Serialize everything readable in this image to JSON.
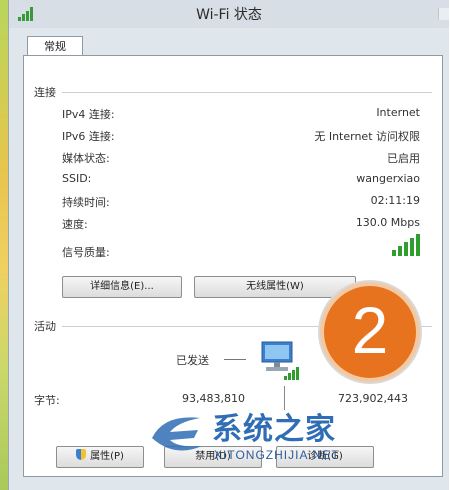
{
  "window": {
    "title": "Wi-Fi 状态"
  },
  "tab": {
    "label": "常规"
  },
  "connection": {
    "section_label": "连接",
    "rows": [
      {
        "label": "IPv4 连接:",
        "value": "Internet"
      },
      {
        "label": "IPv6 连接:",
        "value": "无 Internet 访问权限"
      },
      {
        "label": "媒体状态:",
        "value": "已启用"
      },
      {
        "label": "SSID:",
        "value": "wangerxiao"
      },
      {
        "label": "持续时间:",
        "value": "02:11:19"
      },
      {
        "label": "速度:",
        "value": "130.0 Mbps"
      },
      {
        "label": "信号质量:",
        "value": ""
      }
    ],
    "signal_bars": 5,
    "details_button": "详细信息(E)...",
    "wireless_button": "无线属性(W)"
  },
  "callout": {
    "number": "2"
  },
  "activity": {
    "section_label": "活动",
    "sent_label": "已发送",
    "bytes_label": "字节:",
    "bytes_sent": "93,483,810",
    "bytes_received": "723,902,443"
  },
  "bottom_buttons": {
    "properties": "属性(P)",
    "disable": "禁用(D)",
    "diagnose": "诊断(G)"
  },
  "watermark": {
    "text": "系统之家",
    "url": "XITONGZHIJIA.NET"
  },
  "colors": {
    "signal_green": "#2f9e2f",
    "badge_orange": "#e8731f",
    "watermark_blue": "#2f6db5"
  }
}
